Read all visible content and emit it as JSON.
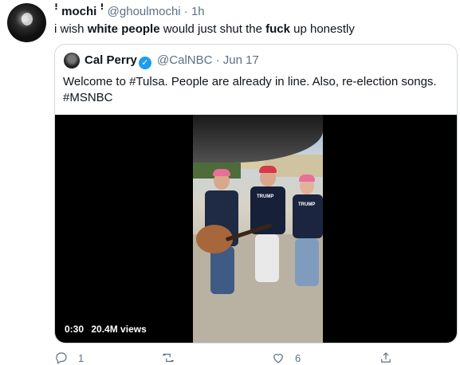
{
  "tweet": {
    "display_name": "ꜝ mochi ꜝ",
    "handle": "@ghoulmochi",
    "separator": "·",
    "time": "1h",
    "text_parts": [
      "i wish ",
      "white people",
      " would just shut the ",
      "fuck",
      " up honestly"
    ]
  },
  "quoted": {
    "display_name": "Cal Perry",
    "verified_icon": "verified-badge-icon",
    "handle": "@CalNBC",
    "separator": "·",
    "date": "Jun 17",
    "line1": "Welcome to #Tulsa. People are already in line. Also, re-election songs.",
    "line2": "#MSNBC",
    "video": {
      "duration": "0:30",
      "views": "20.4M views",
      "shirt_text": "TRUMP"
    }
  },
  "actions": {
    "reply_count": "1",
    "retweet_count": "",
    "like_count": "6",
    "share_count": ""
  },
  "colors": {
    "secondary_text": "#5b7083",
    "border": "#cfd9de",
    "verified": "#1d9bf0"
  }
}
